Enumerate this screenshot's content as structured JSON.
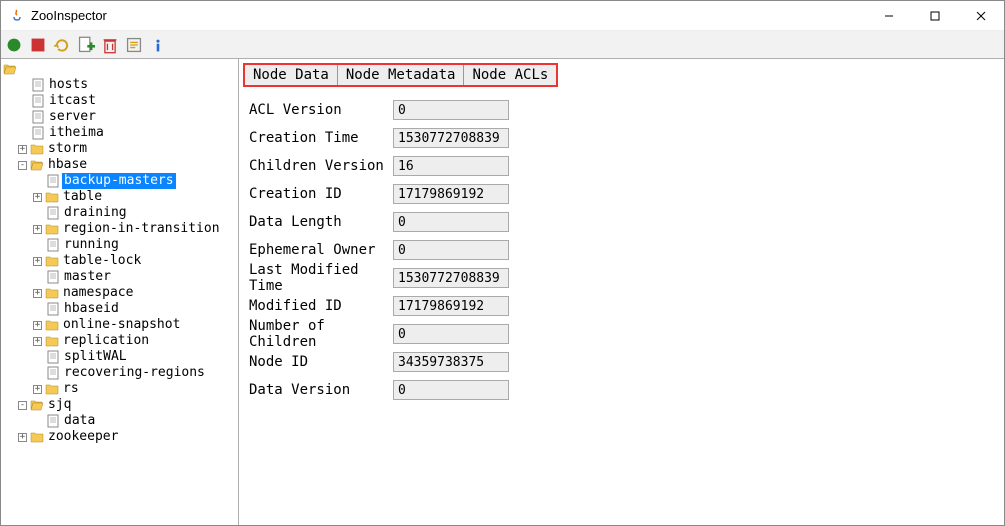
{
  "window": {
    "title": "ZooInspector"
  },
  "tabs": [
    "Node Data",
    "Node Metadata",
    "Node ACLs"
  ],
  "metadata": [
    {
      "label": "ACL Version",
      "value": "0"
    },
    {
      "label": "Creation Time",
      "value": "1530772708839"
    },
    {
      "label": "Children Version",
      "value": "16"
    },
    {
      "label": "Creation ID",
      "value": "17179869192"
    },
    {
      "label": "Data Length",
      "value": "0"
    },
    {
      "label": "Ephemeral Owner",
      "value": "0"
    },
    {
      "label": "Last Modified Time",
      "value": "1530772708839"
    },
    {
      "label": "Modified ID",
      "value": "17179869192"
    },
    {
      "label": "Number of Children",
      "value": "0"
    },
    {
      "label": "Node ID",
      "value": "34359738375"
    },
    {
      "label": "Data Version",
      "value": "0"
    }
  ],
  "tree": {
    "root_children": [
      {
        "t": "f",
        "name": "hosts"
      },
      {
        "t": "f",
        "name": "itcast"
      },
      {
        "t": "f",
        "name": "server"
      },
      {
        "t": "f",
        "name": "itheima"
      },
      {
        "t": "d",
        "name": "storm",
        "open": false
      },
      {
        "t": "d",
        "name": "hbase",
        "open": true,
        "children": [
          {
            "t": "f",
            "name": "backup-masters",
            "selected": true
          },
          {
            "t": "d",
            "name": "table",
            "open": false
          },
          {
            "t": "f",
            "name": "draining"
          },
          {
            "t": "d",
            "name": "region-in-transition",
            "open": false
          },
          {
            "t": "f",
            "name": "running"
          },
          {
            "t": "d",
            "name": "table-lock",
            "open": false
          },
          {
            "t": "f",
            "name": "master"
          },
          {
            "t": "d",
            "name": "namespace",
            "open": false
          },
          {
            "t": "f",
            "name": "hbaseid"
          },
          {
            "t": "d",
            "name": "online-snapshot",
            "open": false
          },
          {
            "t": "d",
            "name": "replication",
            "open": false
          },
          {
            "t": "f",
            "name": "splitWAL"
          },
          {
            "t": "f",
            "name": "recovering-regions"
          },
          {
            "t": "d",
            "name": "rs",
            "open": false
          }
        ]
      },
      {
        "t": "d",
        "name": "sjq",
        "open": true,
        "children": [
          {
            "t": "f",
            "name": "data"
          }
        ]
      },
      {
        "t": "d",
        "name": "zookeeper",
        "open": false
      }
    ]
  }
}
